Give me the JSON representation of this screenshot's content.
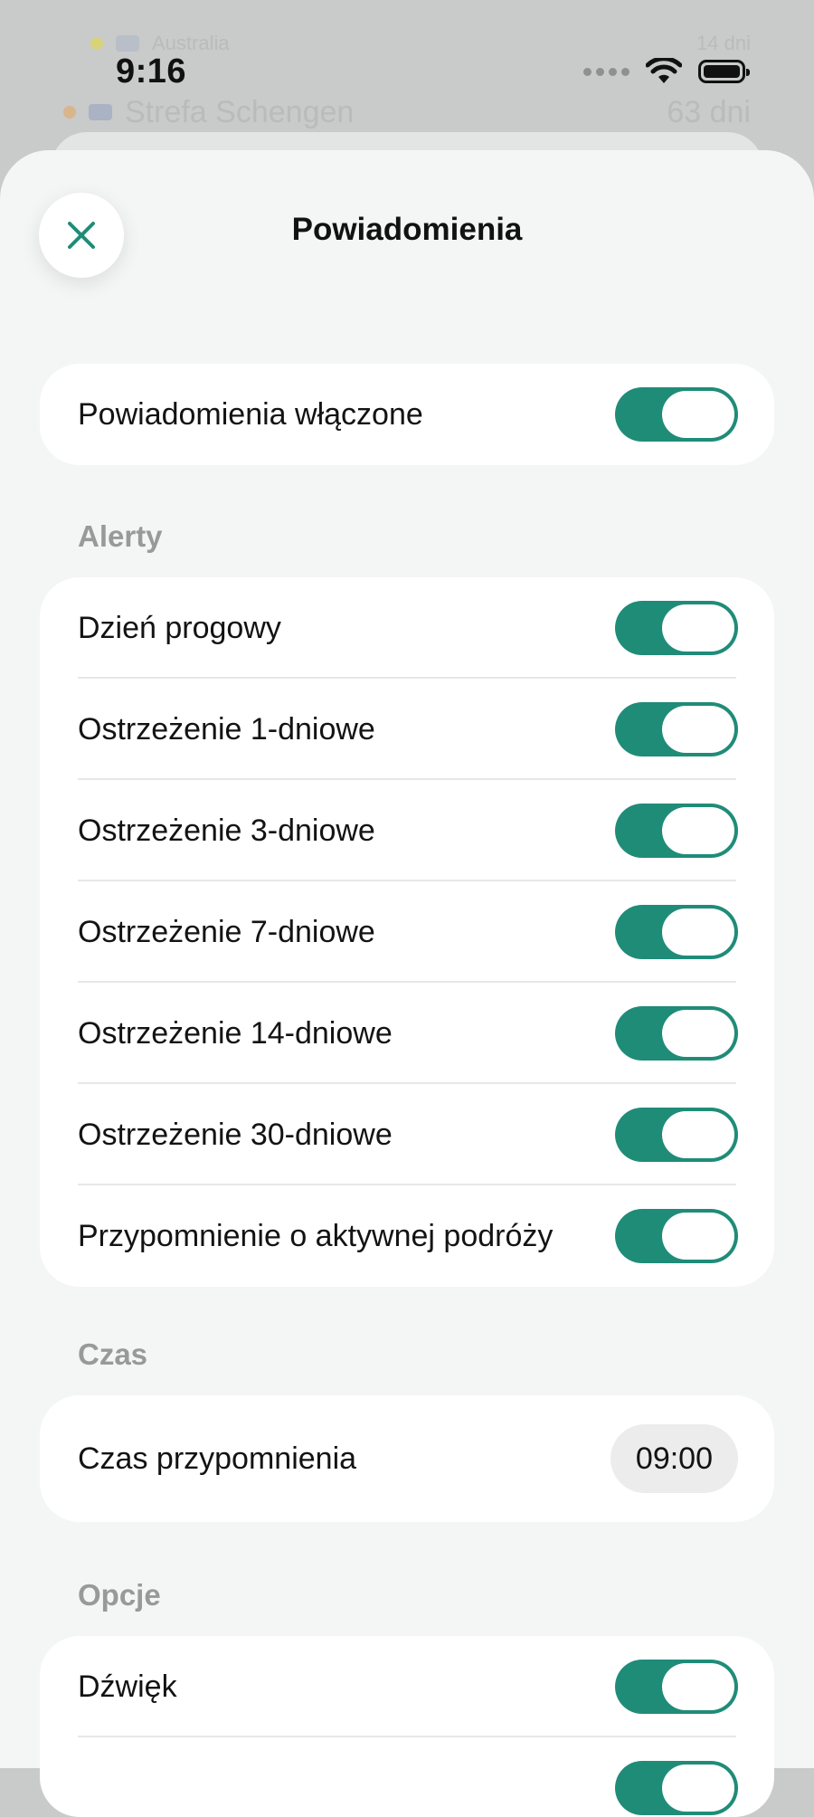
{
  "status_bar": {
    "time": "9:16",
    "icons": [
      "cellular-dots-icon",
      "wifi-icon",
      "battery-icon"
    ]
  },
  "background": {
    "row1": {
      "title": "Australia",
      "value": "14 dni"
    },
    "row2": {
      "title": "Strefa Schengen",
      "value": "63 dni"
    }
  },
  "sheet": {
    "title": "Powiadomienia",
    "close_icon": "close-icon",
    "accent_color": "#1f8c78",
    "master": {
      "label": "Powiadomienia włączone",
      "on": true
    },
    "alerts": {
      "header": "Alerty",
      "items": [
        {
          "label": "Dzień progowy",
          "on": true
        },
        {
          "label": "Ostrzeżenie 1-dniowe",
          "on": true
        },
        {
          "label": "Ostrzeżenie 3-dniowe",
          "on": true
        },
        {
          "label": "Ostrzeżenie 7-dniowe",
          "on": true
        },
        {
          "label": "Ostrzeżenie 14-dniowe",
          "on": true
        },
        {
          "label": "Ostrzeżenie 30-dniowe",
          "on": true
        },
        {
          "label": "Przypomnienie o aktywnej podróży",
          "on": true
        }
      ]
    },
    "time": {
      "header": "Czas",
      "label": "Czas przypomnienia",
      "value": "09:00"
    },
    "options": {
      "header": "Opcje",
      "items": [
        {
          "label": "Dźwięk",
          "on": true
        },
        {
          "label": "",
          "on": true
        }
      ]
    }
  }
}
